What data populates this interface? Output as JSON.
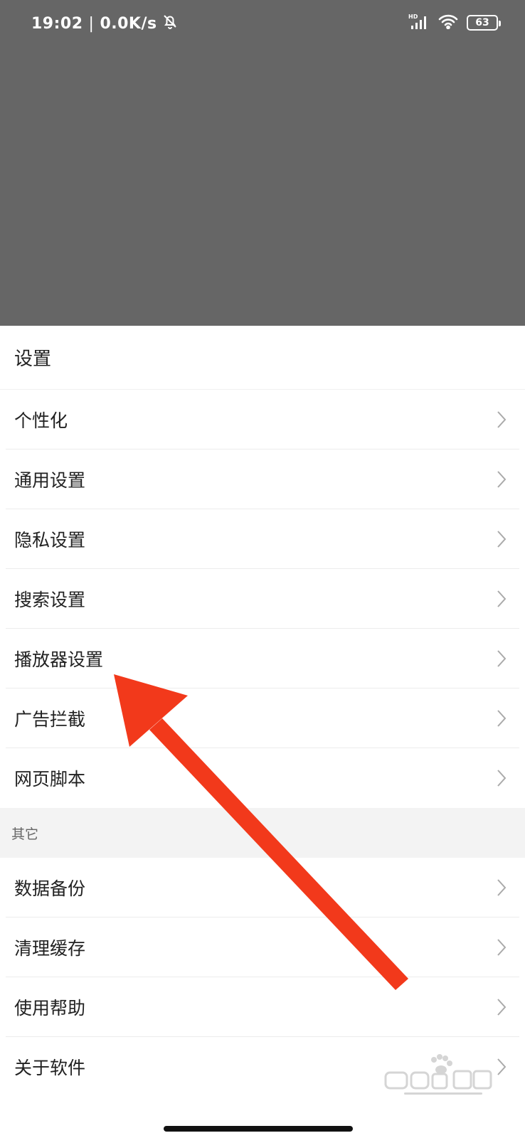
{
  "status_bar": {
    "time": "19:02",
    "separator": "|",
    "network_speed": "0.0K/s",
    "mute_icon": "bell-off-icon",
    "signal_label": "HD",
    "battery_level": "63"
  },
  "sheet": {
    "title": "设置",
    "section_main": [
      {
        "label": "个性化"
      },
      {
        "label": "通用设置"
      },
      {
        "label": "隐私设置"
      },
      {
        "label": "搜索设置"
      },
      {
        "label": "播放器设置"
      },
      {
        "label": "广告拦截"
      },
      {
        "label": "网页脚本"
      }
    ],
    "section_other_header": "其它",
    "section_other": [
      {
        "label": "数据备份"
      },
      {
        "label": "清理缓存"
      },
      {
        "label": "使用帮助"
      },
      {
        "label": "关于软件"
      }
    ]
  },
  "annotation": {
    "arrow_color": "#f2391b"
  },
  "colors": {
    "overlay": "#666666",
    "sheet_bg": "#ffffff",
    "section_bg": "#f3f3f3"
  }
}
